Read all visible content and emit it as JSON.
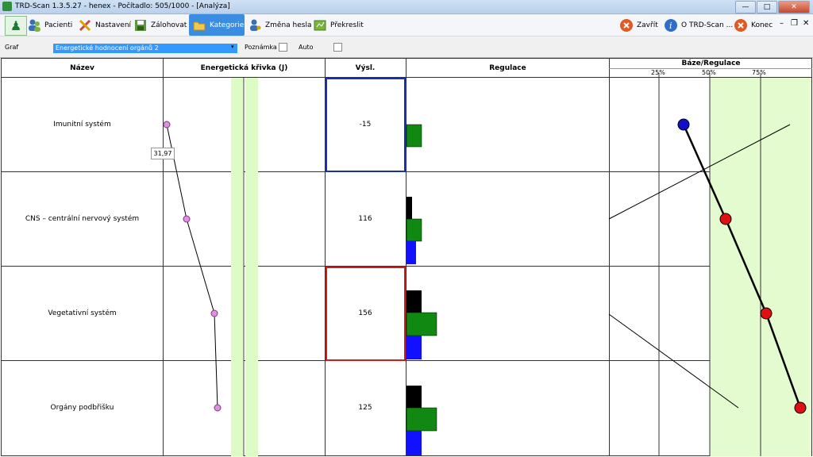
{
  "window": {
    "title": "TRD-Scan 1.3.5.27  - henex - Počítadlo: 505/1000 - [Analýza]"
  },
  "toolbar": {
    "patients": "Pacienti",
    "settings": "Nastavení",
    "backup": "Zálohovat",
    "categories": "Kategorie",
    "change_password": "Změna hesla",
    "redraw": "Překreslit",
    "close": "Zavřít",
    "about": "O TRD-Scan ...",
    "end": "Konec"
  },
  "controls": {
    "graph_label": "Graf",
    "graph_value": "Energetické hodnocení orgánů 2",
    "note_label": "Poznámka",
    "auto_label": "Auto"
  },
  "table": {
    "headers": {
      "name": "Název",
      "curve": "Energetická křivka (J)",
      "result": "Výsl.",
      "regulation": "Regulace",
      "base": "Báze/Regulace"
    },
    "ticks": [
      "25%",
      "50%",
      "75%"
    ],
    "rows": [
      {
        "name": "Imunitní systém",
        "value": "-15"
      },
      {
        "name": "CNS – centrální nervový systém",
        "value": "116"
      },
      {
        "name": "Vegetativní systém",
        "value": "156"
      },
      {
        "name": "Orgány podbřišku",
        "value": "125"
      }
    ],
    "tooltip": "31,97"
  },
  "colors": {
    "accent": "#3a8de0",
    "green_band": "#ddfbc4",
    "frame_blue": "#1b2fa8",
    "frame_red": "#c81e1e"
  }
}
